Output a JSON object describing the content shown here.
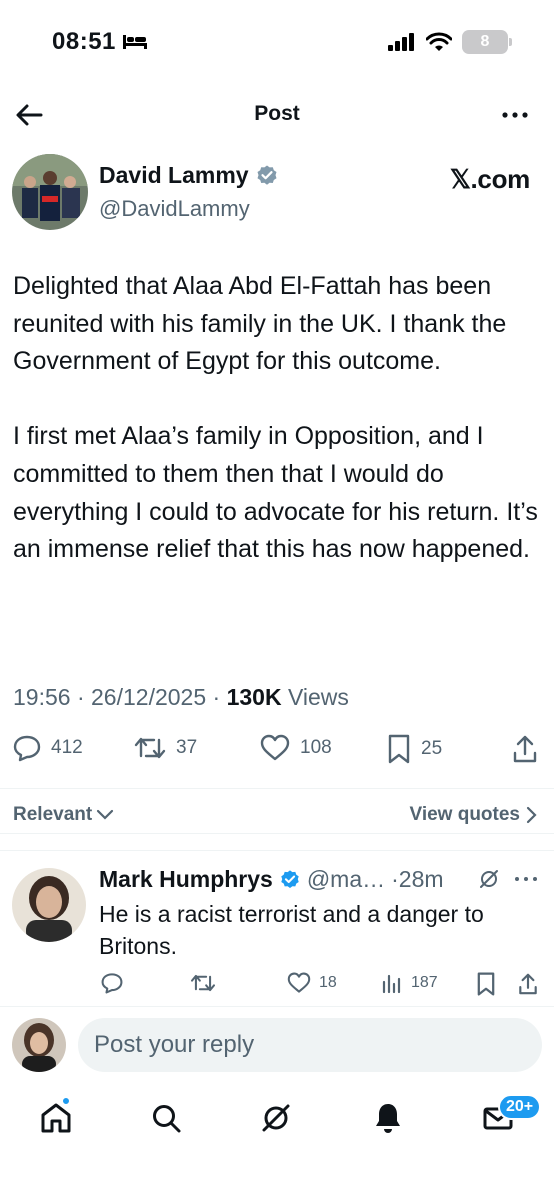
{
  "status_bar": {
    "time": "08:51",
    "battery_level": "8"
  },
  "nav": {
    "title": "Post"
  },
  "author": {
    "name": "David Lammy",
    "handle": "@DavidLammy",
    "verified_color": "#829aab",
    "source": "𝕏.com"
  },
  "tweet": {
    "paragraphs": [
      "Delighted that Alaa Abd El-Fattah has been reunited with his family in the UK. I thank the Government of Egypt for this outcome.",
      "I first met Alaa’s family in Opposition, and I committed to them then that I would do everything I could to advocate for his return. It’s an immense relief that this has now happened."
    ],
    "time": "19:56",
    "date": "26/12/2025",
    "views_count": "130K",
    "views_label": "Views",
    "replies": "412",
    "reposts": "37",
    "likes": "108",
    "bookmarks": "25"
  },
  "filter": {
    "sort_label": "Relevant",
    "view_quotes_label": "View quotes"
  },
  "reply": {
    "name": "Mark Humphrys",
    "handle": "@ma…",
    "age": "·28m",
    "verified_color": "#1d9bf0",
    "text": "He is a racist terrorist and a danger to Britons.",
    "likes": "18",
    "views": "187"
  },
  "composer": {
    "placeholder": "Post your reply"
  },
  "tabs": {
    "messages_badge": "20+"
  },
  "colors": {
    "accent": "#1d9bf0",
    "muted": "#536471",
    "text": "#0f1419"
  }
}
